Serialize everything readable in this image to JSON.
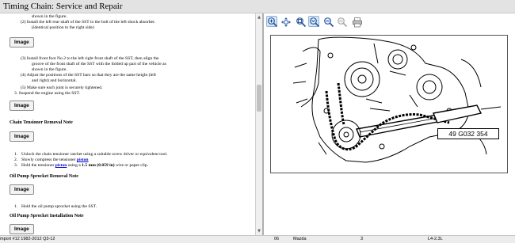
{
  "window": {
    "title": "Timing Chain:  Service and Repair"
  },
  "document": {
    "lines": [
      "shown in the figure.",
      "(2)   Install the left rear shaft of the SST to the bolt of the left shock absorber.",
      "(identical position to the right side)",
      "(3)   Install front foot No.2 to the left right front shaft of the SST, then align the",
      "groove of the front shaft of the SST with the folded up part of the vehicle as",
      "shown in the figure.",
      "(4)   Adjust the positions of the SST bars so that they are the same height (left",
      "and right) and horizontal.",
      "(5)   Make sure each joint is securely tightened.",
      "3.   Suspend the engine using the SST."
    ],
    "image_label": "Image",
    "section1": {
      "heading": "Chain Tensioner Removal Note",
      "step1": "Unlock the chain tensioner ratchet using a suitable screw driver or equivalent tool.",
      "step2_prefix": "Slowly compress the tensioner ",
      "step2_link": "piston",
      "step3_prefix": "Hold the tensioner ",
      "step3_link": "piston",
      "step3_mid": " using a ",
      "step3_bold": "1.5 mm (0.059 in)",
      "step3_suffix": " wire or paper clip."
    },
    "section2": {
      "heading": "Oil Pump Sprocket Removal Note",
      "step1": "Hold the oil pump sprocket using the SST."
    },
    "section3": {
      "heading": "Oil Pump Sprocket Installation Note"
    },
    "numbers": [
      "1.",
      "2.",
      "3."
    ]
  },
  "toolbar": {
    "buttons": [
      {
        "name": "zoom-in-icon",
        "active": true
      },
      {
        "name": "pan-icon",
        "active": false
      },
      {
        "name": "zoom-region-icon",
        "active": false
      },
      {
        "name": "zoom-fit-icon",
        "active": true
      },
      {
        "name": "zoom-out-icon",
        "active": false
      },
      {
        "name": "zoom-out-disabled-icon",
        "active": false
      },
      {
        "name": "print-icon",
        "active": false
      }
    ]
  },
  "figure": {
    "callout": "49 G032 354",
    "code": "am3uuw0000108"
  },
  "status": {
    "left": "mport #12 1982-2012 Q3-12",
    "c1": "06",
    "c2": "Mazda",
    "c3": "3",
    "c4": "L4-2.3L"
  },
  "colors": {
    "link": "#0000cc",
    "active_tool": "#d7e6f6"
  }
}
